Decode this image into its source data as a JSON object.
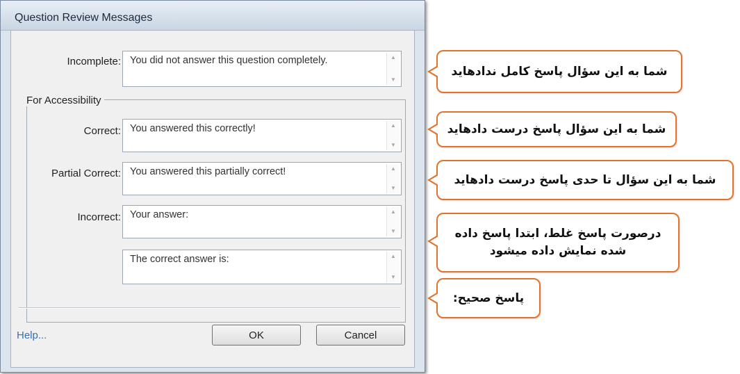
{
  "dialog": {
    "title": "Question Review Messages",
    "incomplete": {
      "label": "Incomplete:",
      "value": "You did not answer this question completely."
    },
    "accessibility_group": "For Accessibility",
    "correct": {
      "label": "Correct:",
      "value": "You answered this correctly!"
    },
    "partial": {
      "label": "Partial Correct:",
      "value": "You answered this partially correct!"
    },
    "incorrect": {
      "label": "Incorrect:",
      "value": "Your answer:"
    },
    "correct_answer": {
      "value": "The correct answer is:"
    },
    "help_link": "Help...",
    "ok_label": "OK",
    "cancel_label": "Cancel"
  },
  "callouts": [
    {
      "text": "شما به این سؤال پاسخ کامل ندادهاید"
    },
    {
      "text": "شما به این سؤال پاسخ درست دادهاید"
    },
    {
      "text": "شما به این سؤال تا حدی پاسخ درست دادهاید"
    },
    {
      "text": "درصورت پاسخ غلط، ابتدا پاسخ داده شده نمایش داده میشود"
    },
    {
      "text": "پاسخ صحیح:"
    }
  ],
  "colors": {
    "callout_border": "#e0742c",
    "link": "#3b6fb0"
  }
}
